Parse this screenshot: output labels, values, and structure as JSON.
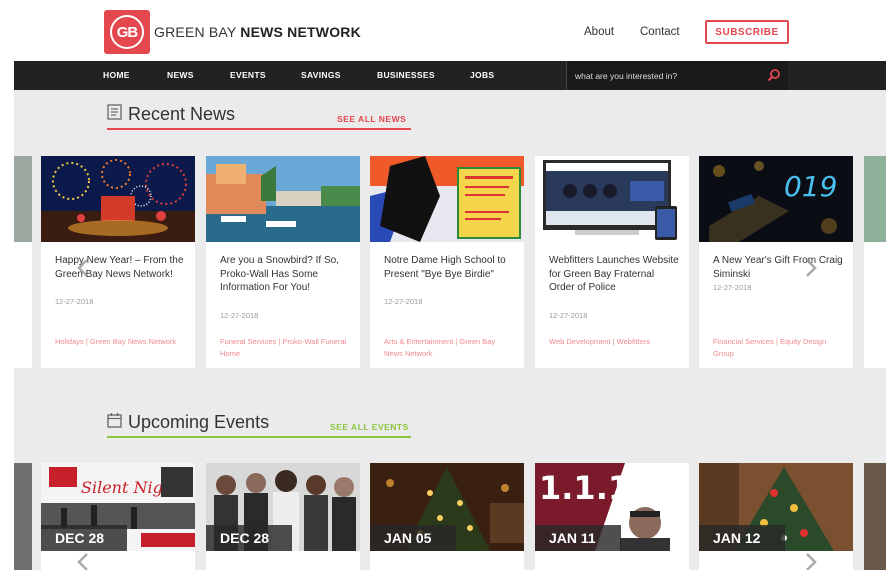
{
  "header": {
    "logo_text": "GB",
    "brand_light": "GREEN BAY ",
    "brand_bold": "NEWS NETWORK",
    "links": [
      "About",
      "Contact"
    ],
    "subscribe_label": "SUBSCRIBE"
  },
  "nav": {
    "items": [
      "HOME",
      "NEWS",
      "EVENTS",
      "SAVINGS",
      "BUSINESSES",
      "JOBS"
    ],
    "search_placeholder": "what are you interested in?"
  },
  "news": {
    "title": "Recent News",
    "see_all": "SEE ALL NEWS",
    "accent": "#e4474e",
    "cards": [
      {
        "title": "Happy New Year! – From the Green Bay News Network!",
        "date": "12-27-2018",
        "categories": "Holidays | Green Bay News Network"
      },
      {
        "title": "Are you a Snowbird? If So, Proko-Wall Has Some Information For You!",
        "date": "12-27-2018",
        "categories": "Funeral Services | Proko-Wall Funeral Home"
      },
      {
        "title": "Notre Dame High School to Present \"Bye Bye Birdie\"",
        "date": "12-27-2018",
        "categories": "Arts & Entertainment | Green Bay News Network"
      },
      {
        "title": "Webfitters Launches Website for Green Bay Fraternal Order of Police",
        "date": "12-27-2018",
        "categories": "Web Development | Webfitters"
      },
      {
        "title": "A New Year's Gift From Craig Siminski",
        "date": "12-27-2018",
        "categories": "Financial Services | Equity Design Group"
      }
    ]
  },
  "events": {
    "title": "Upcoming Events",
    "see_all": "SEE ALL EVENTS",
    "accent": "#8cc63f",
    "cards": [
      {
        "date": "DEC 28"
      },
      {
        "date": "DEC 28"
      },
      {
        "date": "JAN 05"
      },
      {
        "date": "JAN 11"
      },
      {
        "date": "JAN 12"
      }
    ]
  }
}
